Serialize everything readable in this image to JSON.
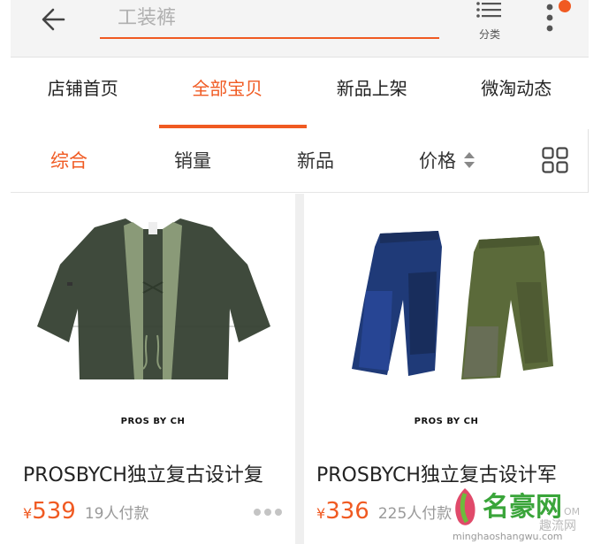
{
  "search": {
    "placeholder": "工装裤",
    "category_label": "分类"
  },
  "tabs": [
    {
      "label": "店铺首页",
      "active": false
    },
    {
      "label": "全部宝贝",
      "active": true
    },
    {
      "label": "新品上架",
      "active": false
    },
    {
      "label": "微淘动态",
      "active": false
    }
  ],
  "sort": {
    "items": [
      {
        "label": "综合",
        "active": true
      },
      {
        "label": "销量",
        "active": false
      },
      {
        "label": "新品",
        "active": false
      },
      {
        "label": "价格",
        "active": false
      }
    ]
  },
  "products": [
    {
      "brand": "PROS BY CH",
      "title": "PROSBYCH独立复古设计复",
      "currency": "¥",
      "price": "539",
      "sold": "19人付款"
    },
    {
      "brand": "PROS BY CH",
      "title": "PROSBYCH独立复古设计军",
      "currency": "¥",
      "price": "336",
      "sold": "225人付款"
    }
  ],
  "watermark": {
    "name": "名豪网",
    "sub": "趣流网",
    "url": "minghaoshangwu.com",
    "com": "OM"
  },
  "colors": {
    "accent": "#f05a22",
    "text": "#222222",
    "muted": "#999999"
  }
}
